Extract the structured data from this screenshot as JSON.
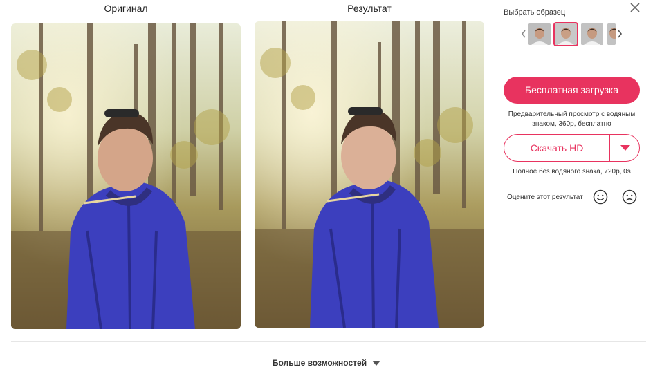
{
  "columns": {
    "original_label": "Оригинал",
    "result_label": "Результат"
  },
  "panel": {
    "title": "Выбрать образец",
    "free_button": "Бесплатная загрузка",
    "free_note": "Предварительный просмотр с водяным знаком, 360p, бесплатно",
    "hd_button": "Скачать HD",
    "hd_note": "Полное без водяного знака, 720p, 0s",
    "rate_label": "Оцените этот результат"
  },
  "footer": {
    "more_label": "Больше возможностей"
  },
  "colors": {
    "accent": "#e8335f"
  },
  "icons": {
    "close": "close-icon",
    "prev": "chevron-left-icon",
    "next": "chevron-right-icon",
    "happy": "smile-face-icon",
    "sad": "sad-face-icon",
    "dropdown": "caret-down-icon"
  }
}
